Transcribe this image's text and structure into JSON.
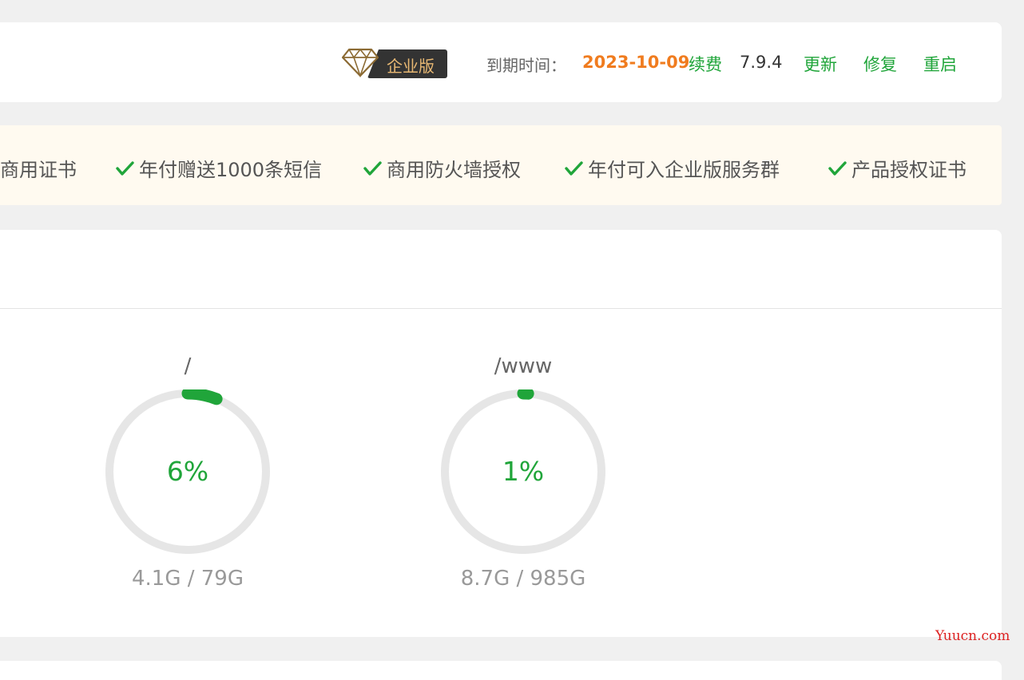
{
  "header": {
    "edition_label": "企业版",
    "expire_label": "到期时间：",
    "expire_date": "2023-10-09",
    "renew_label": "续费",
    "version": "7.9.4",
    "update_label": "更新",
    "repair_label": "修复",
    "restart_label": "重启"
  },
  "benefits": [
    "商用证书",
    "年付赠送1000条短信",
    "商用防火墙授权",
    "年付可入企业版服务群",
    "产品授权证书"
  ],
  "disks": [
    {
      "path": "/",
      "percent_label": "6%",
      "percent": 0.06,
      "usage": "4.1G / 79G"
    },
    {
      "path": "/www",
      "percent_label": "1%",
      "percent": 0.01,
      "usage": "8.7G / 985G"
    }
  ],
  "watermark": "Yuucn.com",
  "colors": {
    "accent_green": "#20a53a",
    "date_orange": "#f07c1f",
    "badge_gold": "#e8b873",
    "ring_track": "#e6e6e6"
  },
  "icons": {
    "edition": "diamond-icon",
    "benefit": "check-icon"
  }
}
